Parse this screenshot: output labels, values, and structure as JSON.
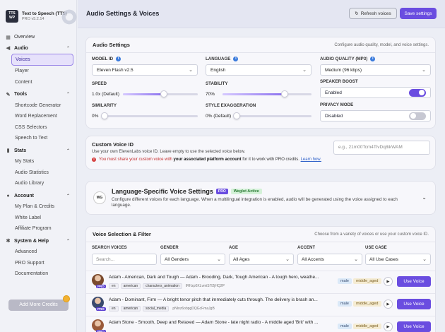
{
  "app": {
    "logo_text": "TTS WP",
    "title": "Text to Speech (TTS)",
    "version": "PRO v5.2.14"
  },
  "sidebar": {
    "overview": "Overview",
    "audio_section": "Audio",
    "audio_items": [
      "Voices",
      "Player",
      "Content"
    ],
    "tools_section": "Tools",
    "tools_items": [
      "Shortcode Generator",
      "Word Replacement",
      "CSS Selectors",
      "Speech to Text"
    ],
    "stats_section": "Stats",
    "stats_items": [
      "My Stats",
      "Audio Statistics",
      "Audio Library"
    ],
    "account_section": "Account",
    "account_items": [
      "My Plan & Credits",
      "White Label",
      "Affiliate Program"
    ],
    "help_section": "System & Help",
    "help_items": [
      "Advanced",
      "PRO Support",
      "Documentation"
    ],
    "add_credits": "Add More Credits"
  },
  "header": {
    "title": "Audio Settings & Voices",
    "refresh_label": "Refresh voices",
    "save_label": "Save settings"
  },
  "audio_settings": {
    "title": "Audio Settings",
    "description": "Configure audio quality, model, and voice settings.",
    "model_label": "MODEL ID",
    "model_value": "Eleven Flash v2.5",
    "language_label": "LANGUAGE",
    "language_value": "English",
    "quality_label": "AUDIO QUALITY (MP3)",
    "quality_value": "Medium (96 kbps)",
    "speed_label": "SPEED",
    "speed_value": "1.0x (Default)",
    "speed_level": 0.55,
    "stability_label": "STABILITY",
    "stability_value": "70%",
    "stability_level": 0.7,
    "boost_label": "SPEAKER BOOST",
    "boost_value": "Enabled",
    "similarity_label": "SIMILARITY",
    "similarity_value": "0%",
    "similarity_level": 0,
    "style_label": "STYLE EXAGGERATION",
    "style_value": "0% (Default)",
    "style_level": 0,
    "privacy_label": "PRIVACY MODE",
    "privacy_value": "Disabled"
  },
  "custom_voice": {
    "title": "Custom Voice ID",
    "description": "Use your own ElevenLabs voice ID. Leave empty to use the selected voice below.",
    "warning_prefix": "You must share your custom voice with",
    "warning_bold": "your associated platform account",
    "warning_suffix": "for it to work with PRO credits.",
    "learn_more": "Learn how.",
    "placeholder": "e.g., 21m00Tcm4TlvDq8ikWAM"
  },
  "language_settings": {
    "logo": "WG",
    "title": "Language-Specific Voice Settings",
    "pro_badge": "PRO",
    "status_badge": "Weglot Active",
    "description": "Configure different voices for each language. When a multilingual integration is enabled, audio will be generated using the voice assigned to each language."
  },
  "voice_selection": {
    "title": "Voice Selection & Filter",
    "description": "Choose from a variety of voices or use your custom voice ID.",
    "search_label": "SEARCH VOICES",
    "search_placeholder": "Search...",
    "gender_label": "GENDER",
    "gender_value": "All Genders",
    "age_label": "AGE",
    "age_value": "All Ages",
    "accent_label": "ACCENT",
    "accent_value": "All Accents",
    "usecase_label": "USE CASE",
    "usecase_value": "All Use Cases",
    "use_voice_label": "Use Voice",
    "avatar_badge": "PRO",
    "voices": [
      {
        "name": "Adam - American, Dark and Tough — Adam - Brooding, Dark, Tough American - A tough hero, weathe...",
        "tags": [
          "en",
          "american",
          "characters_animation"
        ],
        "id": "lRHzp0XLvmiS7l2jHQ2P",
        "gender": "male",
        "age": "middle_aged",
        "avatar_color": "#7b4b2e"
      },
      {
        "name": "Adam - Dominant, Firm — A bright tenor pitch that immediately cuts through. The delivery is brash an...",
        "tags": [
          "en",
          "american",
          "social_media"
        ],
        "id": "pNInz6obpgDQGcFmaJgB",
        "gender": "male",
        "age": "middle_aged",
        "avatar_color": "#3a4a6e"
      },
      {
        "name": "Adam Stone - Smooth, Deep and Relaxed — Adam Stone - late night radio - A middle aged 'Brit' with ...",
        "tags": [],
        "id": "",
        "gender": "male",
        "age": "middle_aged",
        "avatar_color": "#9a5a3a"
      }
    ]
  }
}
